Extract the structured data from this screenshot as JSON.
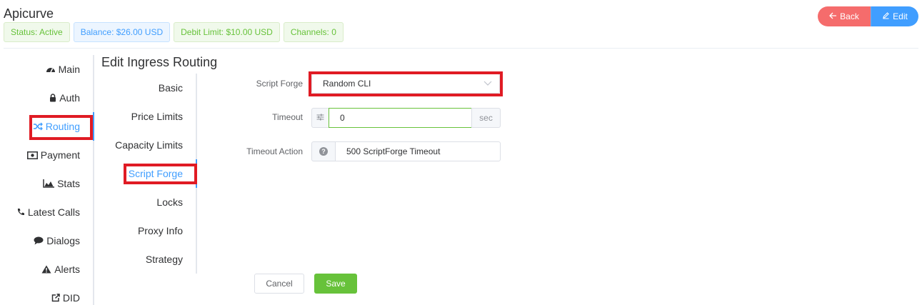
{
  "app": {
    "title": "Apicurve"
  },
  "badges": [
    {
      "label": "Status: Active",
      "color": "#67c23a"
    },
    {
      "label": "Balance: $26.00 USD",
      "color": "#409eff"
    },
    {
      "label": "Debit Limit: $10.00 USD",
      "color": "#67c23a"
    },
    {
      "label": "Channels: 0",
      "color": "#67c23a"
    }
  ],
  "header_actions": {
    "back_label": "Back",
    "back_icon": "arrow-left-icon",
    "edit_label": "Edit",
    "edit_icon": "pencil-icon"
  },
  "left_nav": {
    "active": "Routing",
    "items": [
      {
        "label": "Main",
        "icon": "dashboard-icon"
      },
      {
        "label": "Auth",
        "icon": "lock-icon"
      },
      {
        "label": "Routing",
        "icon": "shuffle-icon"
      },
      {
        "label": "Payment",
        "icon": "money-icon"
      },
      {
        "label": "Stats",
        "icon": "area-chart-icon"
      },
      {
        "label": "Latest Calls",
        "icon": "phone-icon"
      },
      {
        "label": "Dialogs",
        "icon": "comment-icon"
      },
      {
        "label": "Alerts",
        "icon": "warning-icon"
      },
      {
        "label": "DID",
        "icon": "external-link-icon"
      }
    ]
  },
  "section": {
    "title": "Edit Ingress Routing"
  },
  "sub_nav": {
    "active": "Script Forge",
    "items": [
      {
        "label": "Basic"
      },
      {
        "label": "Price Limits"
      },
      {
        "label": "Capacity Limits"
      },
      {
        "label": "Script Forge"
      },
      {
        "label": "Locks"
      },
      {
        "label": "Proxy Info"
      },
      {
        "label": "Strategy"
      }
    ]
  },
  "form": {
    "script_forge": {
      "label": "Script Forge",
      "value": "Random CLI",
      "icon": "chevron-down-icon"
    },
    "timeout": {
      "label": "Timeout",
      "value": "0",
      "suffix": "sec",
      "prefix_icon": "sliders-icon"
    },
    "timeout_action": {
      "label": "Timeout Action",
      "value": "500 ScriptForge Timeout",
      "prefix_icon": "question-icon"
    }
  },
  "actions": {
    "cancel_label": "Cancel",
    "save_label": "Save"
  },
  "colors": {
    "primary": "#409eff",
    "success": "#67c23a",
    "danger": "#f56c6c",
    "highlight": "#e01b24"
  }
}
